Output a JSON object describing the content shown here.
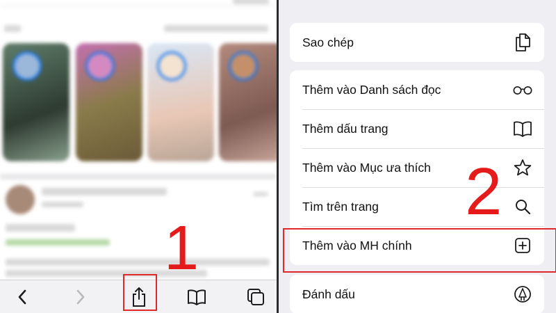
{
  "left": {
    "step_number": "1",
    "toolbar": {
      "back": "chevron-left-icon",
      "forward": "chevron-right-icon",
      "share": "share-icon",
      "bookmarks": "book-icon",
      "tabs": "tabs-icon"
    }
  },
  "right": {
    "step_number": "2",
    "menu": {
      "copy": "Sao chép",
      "reading_list": "Thêm vào Danh sách đọc",
      "bookmark": "Thêm dấu trang",
      "favorites": "Thêm vào Mục ưa thích",
      "find": "Tìm trên trang",
      "add_home": "Thêm vào MH chính",
      "markup": "Đánh dấu"
    }
  },
  "colors": {
    "annotation_red": "#e51b1b",
    "panel_background": "#efeff3"
  }
}
